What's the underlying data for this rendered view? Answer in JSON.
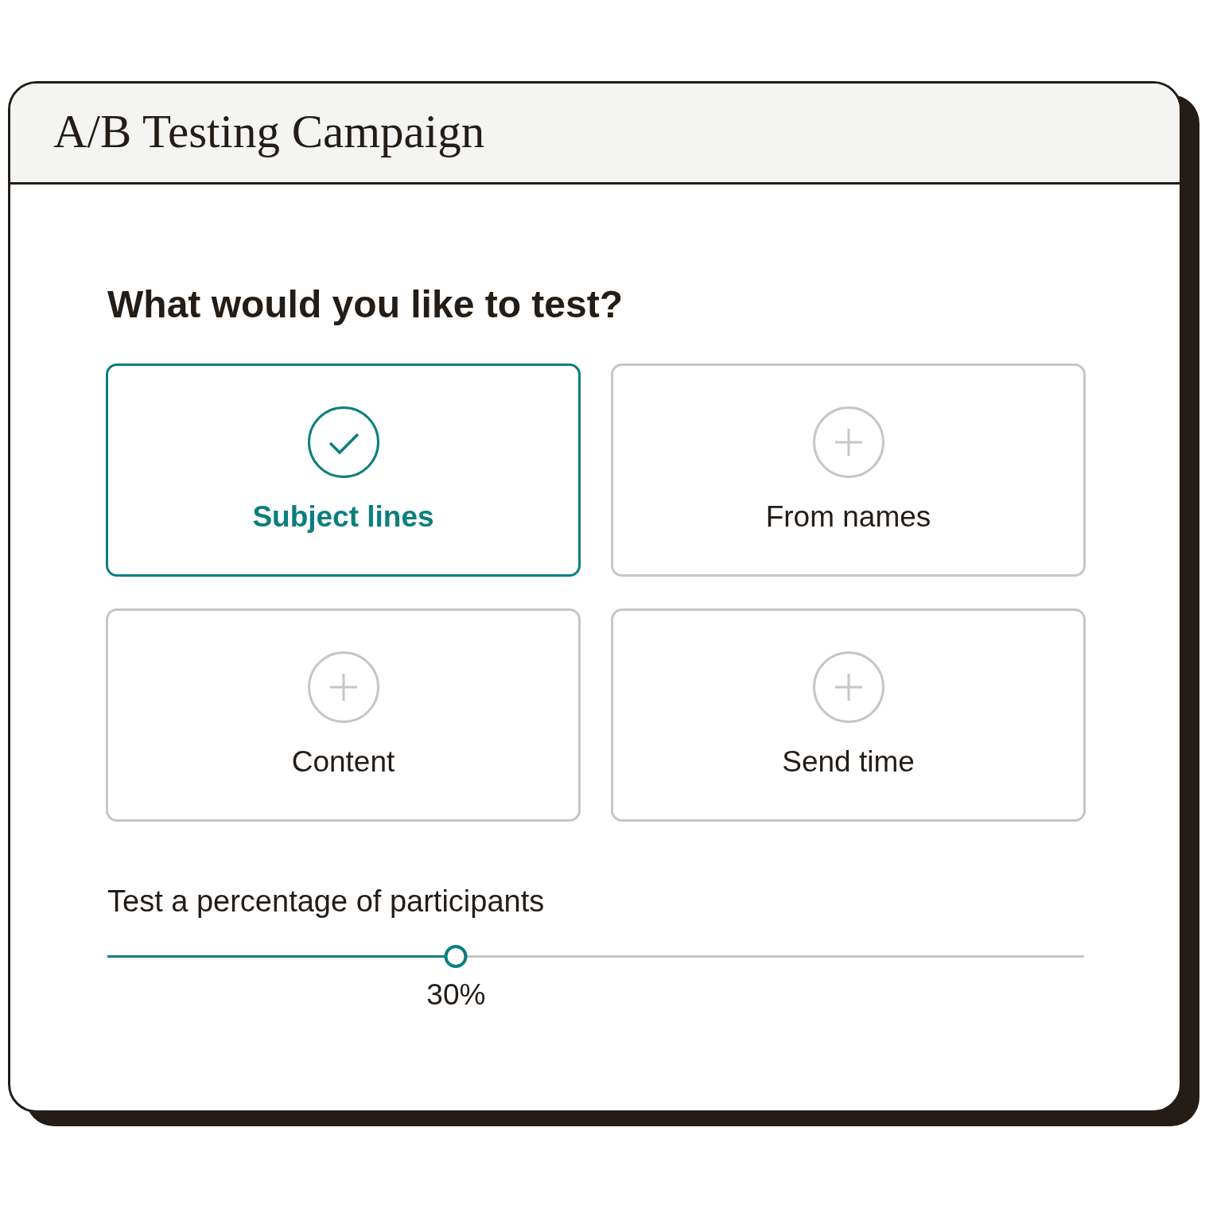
{
  "window": {
    "title": "A/B Testing Campaign"
  },
  "question": "What would you like to test?",
  "options": [
    {
      "label": "Subject lines",
      "selected": true
    },
    {
      "label": "From names",
      "selected": false
    },
    {
      "label": "Content",
      "selected": false
    },
    {
      "label": "Send time",
      "selected": false
    }
  ],
  "slider": {
    "label": "Test a percentage of participants",
    "level": 0.357,
    "reading": "30%"
  }
}
